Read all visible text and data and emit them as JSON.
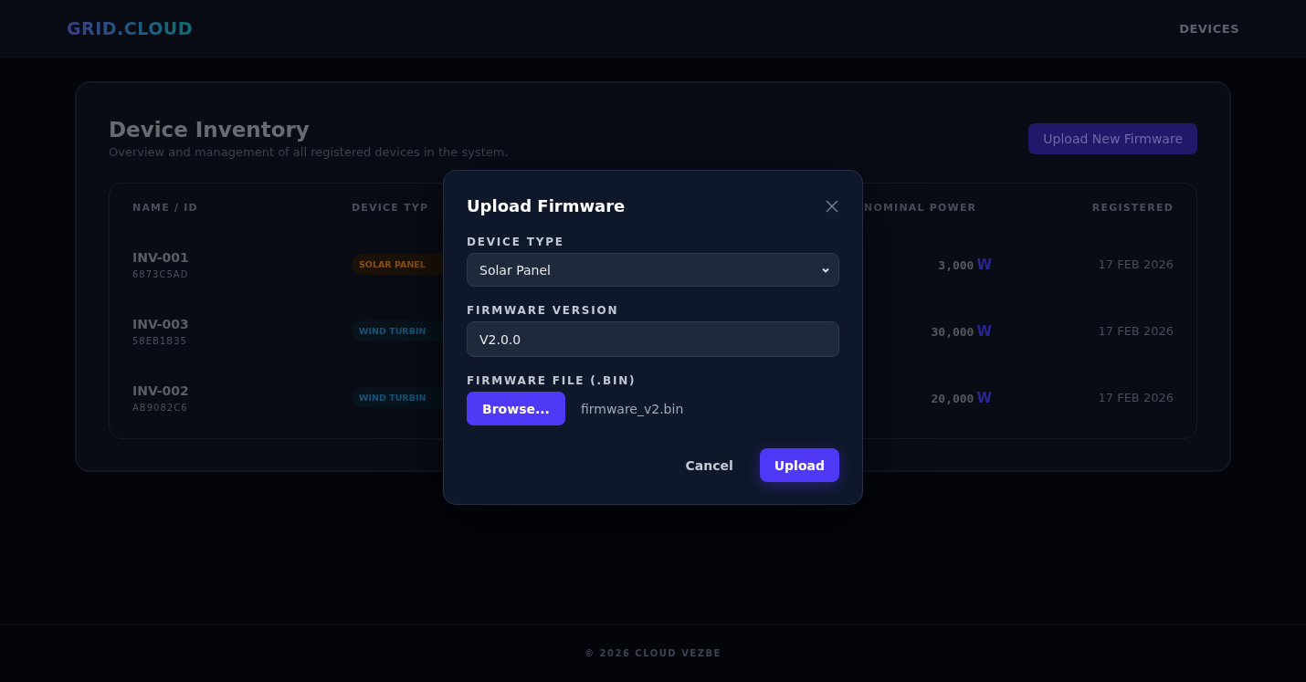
{
  "header": {
    "logo": "GRID.CLOUD",
    "nav": [
      {
        "label": "DEVICES",
        "selected": true
      }
    ]
  },
  "inventory": {
    "title": "Device Inventory",
    "subtitle": "Overview and management of all registered devices in the system.",
    "action": "Upload New Firmware",
    "columns": [
      "NAME / ID",
      "DEVICE TYP",
      "NOMINAL POWER",
      "REGISTERED"
    ],
    "rows": [
      {
        "name": "INV-001",
        "id": "6873C5AD",
        "type": "SOLAR PANEL",
        "kind": "solar",
        "power": "3,000",
        "unit": "W",
        "registered": "17 FEB 2026"
      },
      {
        "name": "INV-003",
        "id": "58EB1B35",
        "type": "WIND TURBIN",
        "kind": "wind",
        "power": "30,000",
        "unit": "W",
        "registered": "17 FEB 2026"
      },
      {
        "name": "INV-002",
        "id": "AB9082C6",
        "type": "WIND TURBIN",
        "kind": "wind",
        "power": "20,000",
        "unit": "W",
        "registered": "17 FEB 2026"
      }
    ]
  },
  "modal": {
    "title": "Upload Firmware",
    "device_type": {
      "label": "DEVICE TYPE",
      "value": "Solar Panel"
    },
    "version": {
      "label": "FIRMWARE VERSION",
      "value": "V2.0.0"
    },
    "file": {
      "label": "FIRMWARE FILE (.BIN)",
      "button": "Browse...",
      "filename": "firmware_v2.bin"
    },
    "buttons": {
      "cancel": "Cancel",
      "confirm": "Upload"
    }
  },
  "footer": "© 2026 CLOUD VEZBE"
}
